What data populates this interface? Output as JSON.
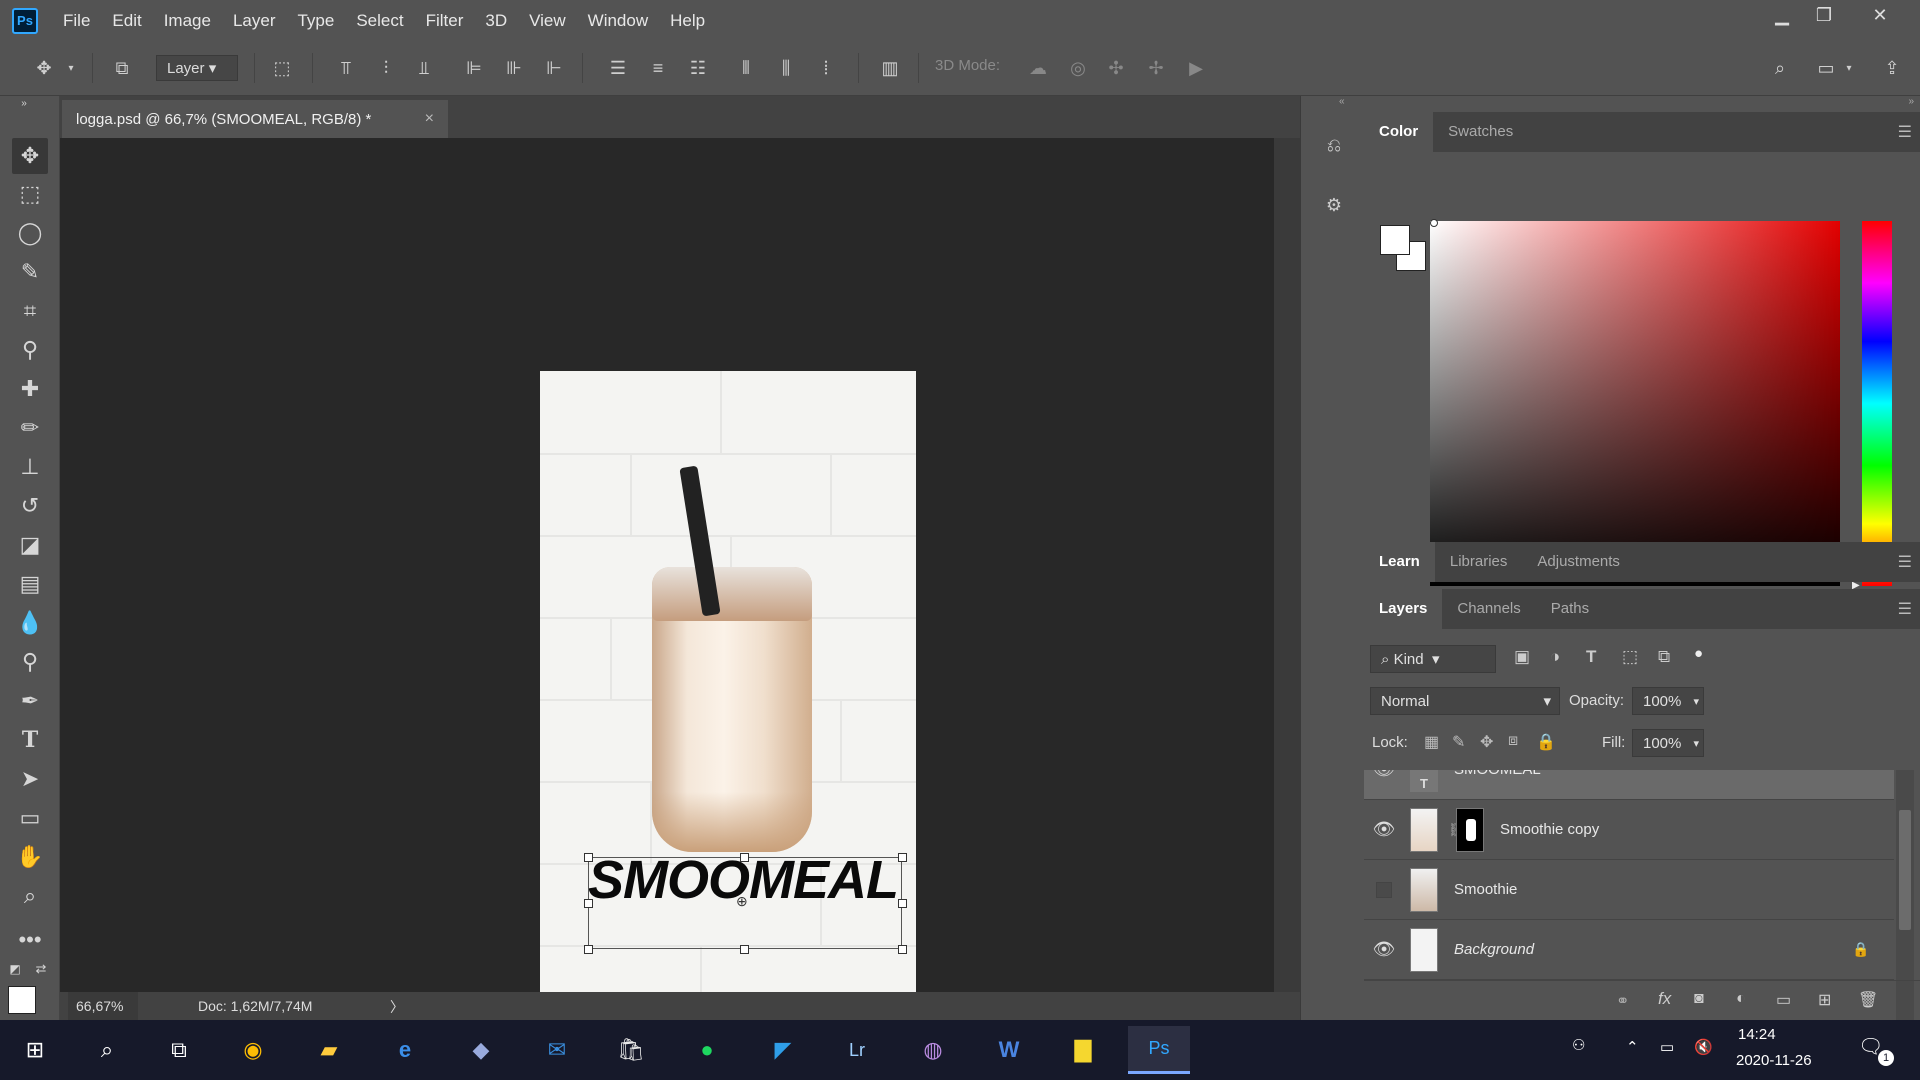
{
  "app": {
    "logo": "Ps"
  },
  "menu": [
    "File",
    "Edit",
    "Image",
    "Layer",
    "Type",
    "Select",
    "Filter",
    "3D",
    "View",
    "Window",
    "Help"
  ],
  "options_bar": {
    "auto_select_target": "Layer",
    "mode_3d_label": "3D Mode:"
  },
  "document": {
    "tab_title": "logga.psd @ 66,7% (SMOOMEAL, RGB/8) *",
    "close_glyph": "×"
  },
  "canvas": {
    "title_text": "SMOOMEAL"
  },
  "status": {
    "zoom": "66,67%",
    "doc_size": "Doc: 1,62M/7,74M",
    "arrow": "〉"
  },
  "color_panel": {
    "tabs": [
      "Color",
      "Swatches"
    ]
  },
  "learn_panel": {
    "tabs": [
      "Learn",
      "Libraries",
      "Adjustments"
    ]
  },
  "layers_panel": {
    "tabs": [
      "Layers",
      "Channels",
      "Paths"
    ],
    "filter_label": "Kind",
    "blend_mode": "Normal",
    "opacity_label": "Opacity:",
    "opacity_value": "100%",
    "lock_label": "Lock:",
    "fill_label": "Fill:",
    "fill_value": "100%",
    "layers": [
      {
        "name": "SMOOMEAL",
        "visible": true
      },
      {
        "name": "Smoothie copy",
        "visible": true
      },
      {
        "name": "Smoothie",
        "visible": false
      },
      {
        "name": "Background",
        "visible": true
      }
    ]
  },
  "taskbar": {
    "time": "14:24",
    "date": "2020-11-26",
    "notifications": "1"
  }
}
